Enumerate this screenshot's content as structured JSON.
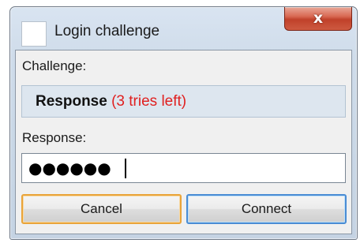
{
  "window": {
    "title": "Login challenge",
    "close_glyph": "x"
  },
  "challenge": {
    "label": "Challenge:",
    "text": "Response",
    "tries_left": "(3 tries left)"
  },
  "response": {
    "label": "Response:",
    "value": "●●●●●●"
  },
  "buttons": {
    "cancel": "Cancel",
    "connect": "Connect"
  },
  "colors": {
    "tries_left": "#e02020",
    "focus_border": "#e9a43a",
    "default_border": "#4a8cd4",
    "close_button": "#c0412a"
  }
}
